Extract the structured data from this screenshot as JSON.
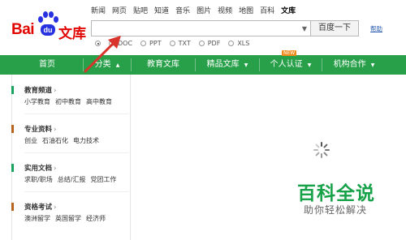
{
  "logo": {
    "bai": "Bai",
    "du": "du",
    "wenku": "文库"
  },
  "top_nav": [
    "新闻",
    "网页",
    "贴吧",
    "知道",
    "音乐",
    "图片",
    "视频",
    "地图",
    "百科",
    "文库"
  ],
  "search": {
    "value": "",
    "button_label": "百度一下",
    "help_label": "帮助"
  },
  "filters": [
    {
      "label": "全部",
      "selected": true
    },
    {
      "label": "DOC",
      "selected": false
    },
    {
      "label": "PPT",
      "selected": false
    },
    {
      "label": "TXT",
      "selected": false
    },
    {
      "label": "PDF",
      "selected": false
    },
    {
      "label": "XLS",
      "selected": false
    }
  ],
  "green_nav": {
    "home": "首页",
    "category": "分类",
    "education": "教育文库",
    "premium": "精品文库",
    "personal": "个人认证",
    "new_badge": "NEW",
    "org": "机构合作"
  },
  "sidebar": [
    {
      "title": "教育频道",
      "color": "#1aa260",
      "links": [
        "小学教育",
        "初中教育",
        "高中教育"
      ]
    },
    {
      "title": "专业资料",
      "color": "#b5651d",
      "links": [
        "创业",
        "石油石化",
        "电力技术"
      ]
    },
    {
      "title": "实用文档",
      "color": "#1aa260",
      "links": [
        "求职/职场",
        "总结/汇报",
        "党团工作"
      ]
    },
    {
      "title": "资格考试",
      "color": "#b5651d",
      "links": [
        "澳洲留学",
        "英国留学",
        "经济师"
      ]
    }
  ],
  "watermark": {
    "title": "百科全说",
    "subtitle": "助你轻松解决"
  },
  "colors": {
    "brand_red": "#e10601",
    "nav_green": "#28a04a",
    "annotation_arrow": "#d9342b"
  }
}
